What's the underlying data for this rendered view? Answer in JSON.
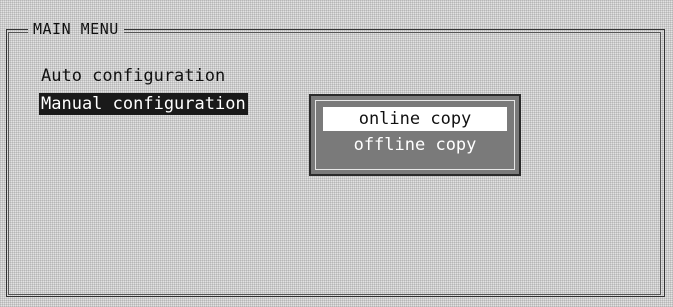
{
  "menu": {
    "title": "MAIN MENU",
    "items": [
      {
        "label": "Auto configuration",
        "selected": false
      },
      {
        "label": "Manual configuration",
        "selected": true
      }
    ]
  },
  "submenu": {
    "items": [
      {
        "label": "online copy",
        "highlighted": true
      },
      {
        "label": "offline copy",
        "highlighted": false
      }
    ]
  },
  "colors": {
    "background": "#e2e2e2",
    "selection": "#1a1a1a",
    "popup": "#7a7a7a"
  }
}
